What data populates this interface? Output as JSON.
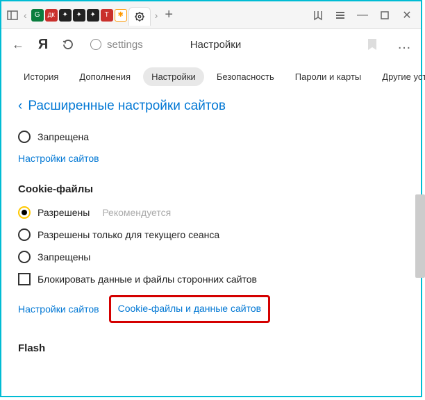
{
  "titlebar": {
    "new_tab": "+"
  },
  "addrbar": {
    "url": "settings",
    "title": "Настройки"
  },
  "nav": {
    "history": "История",
    "addons": "Дополнения",
    "settings": "Настройки",
    "security": "Безопасность",
    "passwords": "Пароли и карты",
    "other": "Другие устр"
  },
  "breadcrumb": "Расширенные настройки сайтов",
  "section1": {
    "forbidden": "Запрещена",
    "site_settings": "Настройки сайтов"
  },
  "cookies": {
    "title": "Cookie-файлы",
    "allowed": "Разрешены",
    "recommend": "Рекомендуется",
    "session_only": "Разрешены только для текущего сеанса",
    "forbidden": "Запрещены",
    "block_third": "Блокировать данные и файлы сторонних сайтов",
    "site_settings": "Настройки сайтов",
    "cookie_data": "Cookie-файлы и данные сайтов"
  },
  "flash": {
    "title": "Flash"
  }
}
